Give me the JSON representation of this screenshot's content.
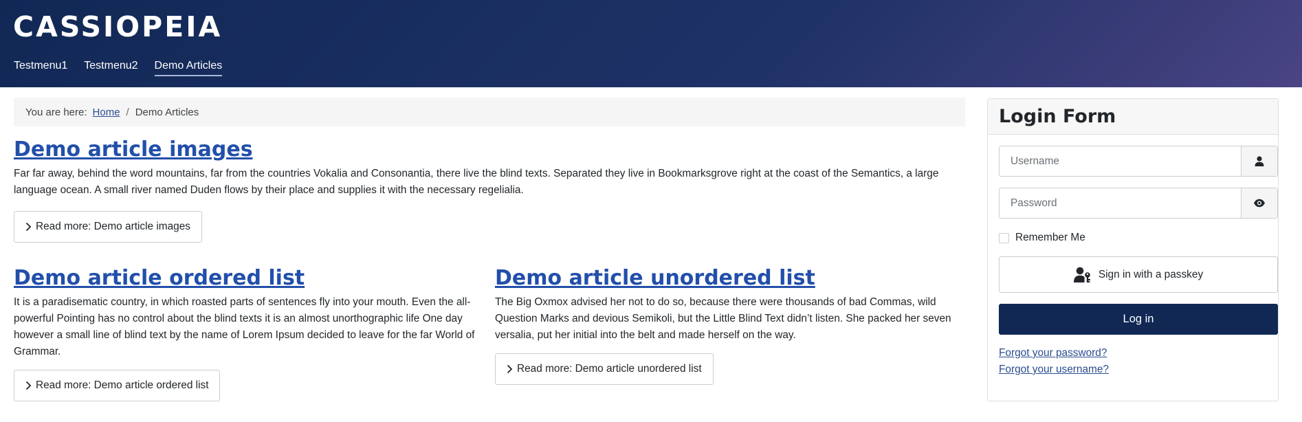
{
  "header": {
    "brand": "CASSIOPEIA",
    "nav": [
      {
        "label": "Testmenu1"
      },
      {
        "label": "Testmenu2"
      },
      {
        "label": "Demo Articles",
        "active": true
      }
    ],
    "gradient_colors": [
      "#112855",
      "#4a4585"
    ]
  },
  "breadcrumb": {
    "prefix": "You are here:",
    "home": "Home",
    "separator": "/",
    "current": "Demo Articles"
  },
  "articles": [
    {
      "title": "Demo article images",
      "text": "Far far away, behind the word mountains, far from the countries Vokalia and Consonantia, there live the blind texts. Separated they live in Bookmarksgrove right at the coast of the Semantics, a large language ocean. A small river named Duden flows by their place and supplies it with the necessary regelialia.",
      "readmore": "Read more: Demo article images"
    },
    {
      "title": "Demo article ordered list",
      "text": "It is a paradisematic country, in which roasted parts of sentences fly into your mouth. Even the all-powerful Pointing has no control about the blind texts it is an almost unorthographic life One day however a small line of blind text by the name of Lorem Ipsum decided to leave for the far World of Grammar.",
      "readmore": "Read more: Demo article ordered list"
    },
    {
      "title": "Demo article unordered list",
      "text": "The Big Oxmox advised her not to do so, because there were thousands of bad Commas, wild Question Marks and devious Semikoli, but the Little Blind Text didn’t listen. She packed her seven versalia, put her initial into the belt and made herself on the way.",
      "readmore": "Read more: Demo article unordered list"
    }
  ],
  "login": {
    "title": "Login Form",
    "username_placeholder": "Username",
    "password_placeholder": "Password",
    "remember": "Remember Me",
    "passkey": "Sign in with a passkey",
    "login_button": "Log in",
    "forgot_password": "Forgot your password?",
    "forgot_username": "Forgot your username?",
    "icons": [
      "user-icon",
      "eye-icon",
      "user-key-icon"
    ],
    "button_color": "#112855",
    "link_color": "#2a4d8f"
  }
}
